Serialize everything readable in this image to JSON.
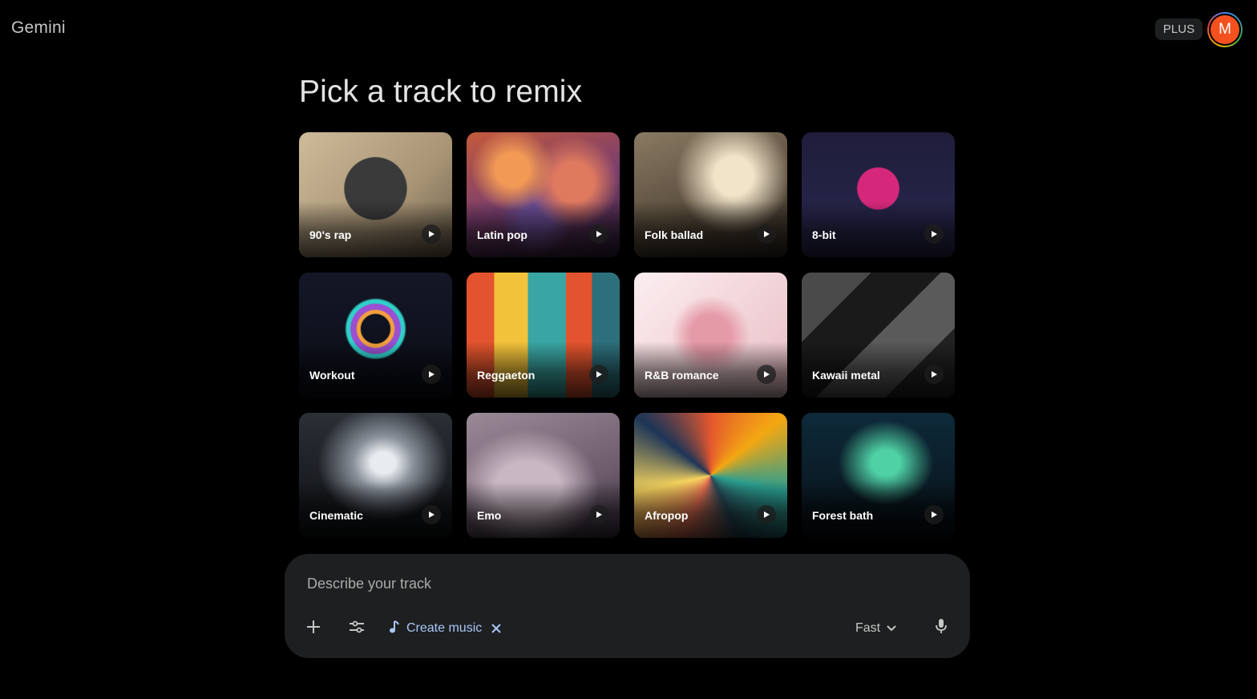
{
  "app": {
    "logo": "Gemini",
    "plan_badge": "PLUS",
    "avatar_initial": "M"
  },
  "main": {
    "title": "Pick a track to remix",
    "tracks": [
      {
        "label": "90's rap",
        "art": "rap"
      },
      {
        "label": "Latin pop",
        "art": "latin"
      },
      {
        "label": "Folk ballad",
        "art": "folk"
      },
      {
        "label": "8-bit",
        "art": "8bit"
      },
      {
        "label": "Workout",
        "art": "workout"
      },
      {
        "label": "Reggaeton",
        "art": "reggaeton"
      },
      {
        "label": "R&B romance",
        "art": "rnb"
      },
      {
        "label": "Kawaii metal",
        "art": "kawaii"
      },
      {
        "label": "Cinematic",
        "art": "cinematic"
      },
      {
        "label": "Emo",
        "art": "emo"
      },
      {
        "label": "Afropop",
        "art": "afropop"
      },
      {
        "label": "Forest bath",
        "art": "forest"
      }
    ]
  },
  "composer": {
    "placeholder": "Describe your track",
    "tool_chip_label": "Create music",
    "mode_label": "Fast",
    "icons": {
      "add": "plus-icon",
      "tools": "tune-icon",
      "chip": "music-note-icon",
      "chip_close": "close-icon",
      "mode": "chevron-down-icon",
      "voice": "mic-icon"
    }
  },
  "colors": {
    "background": "#000000",
    "composer_bg": "#1e1f20",
    "chip_accent": "#a8c7fa",
    "avatar_bg": "#f4511e"
  }
}
